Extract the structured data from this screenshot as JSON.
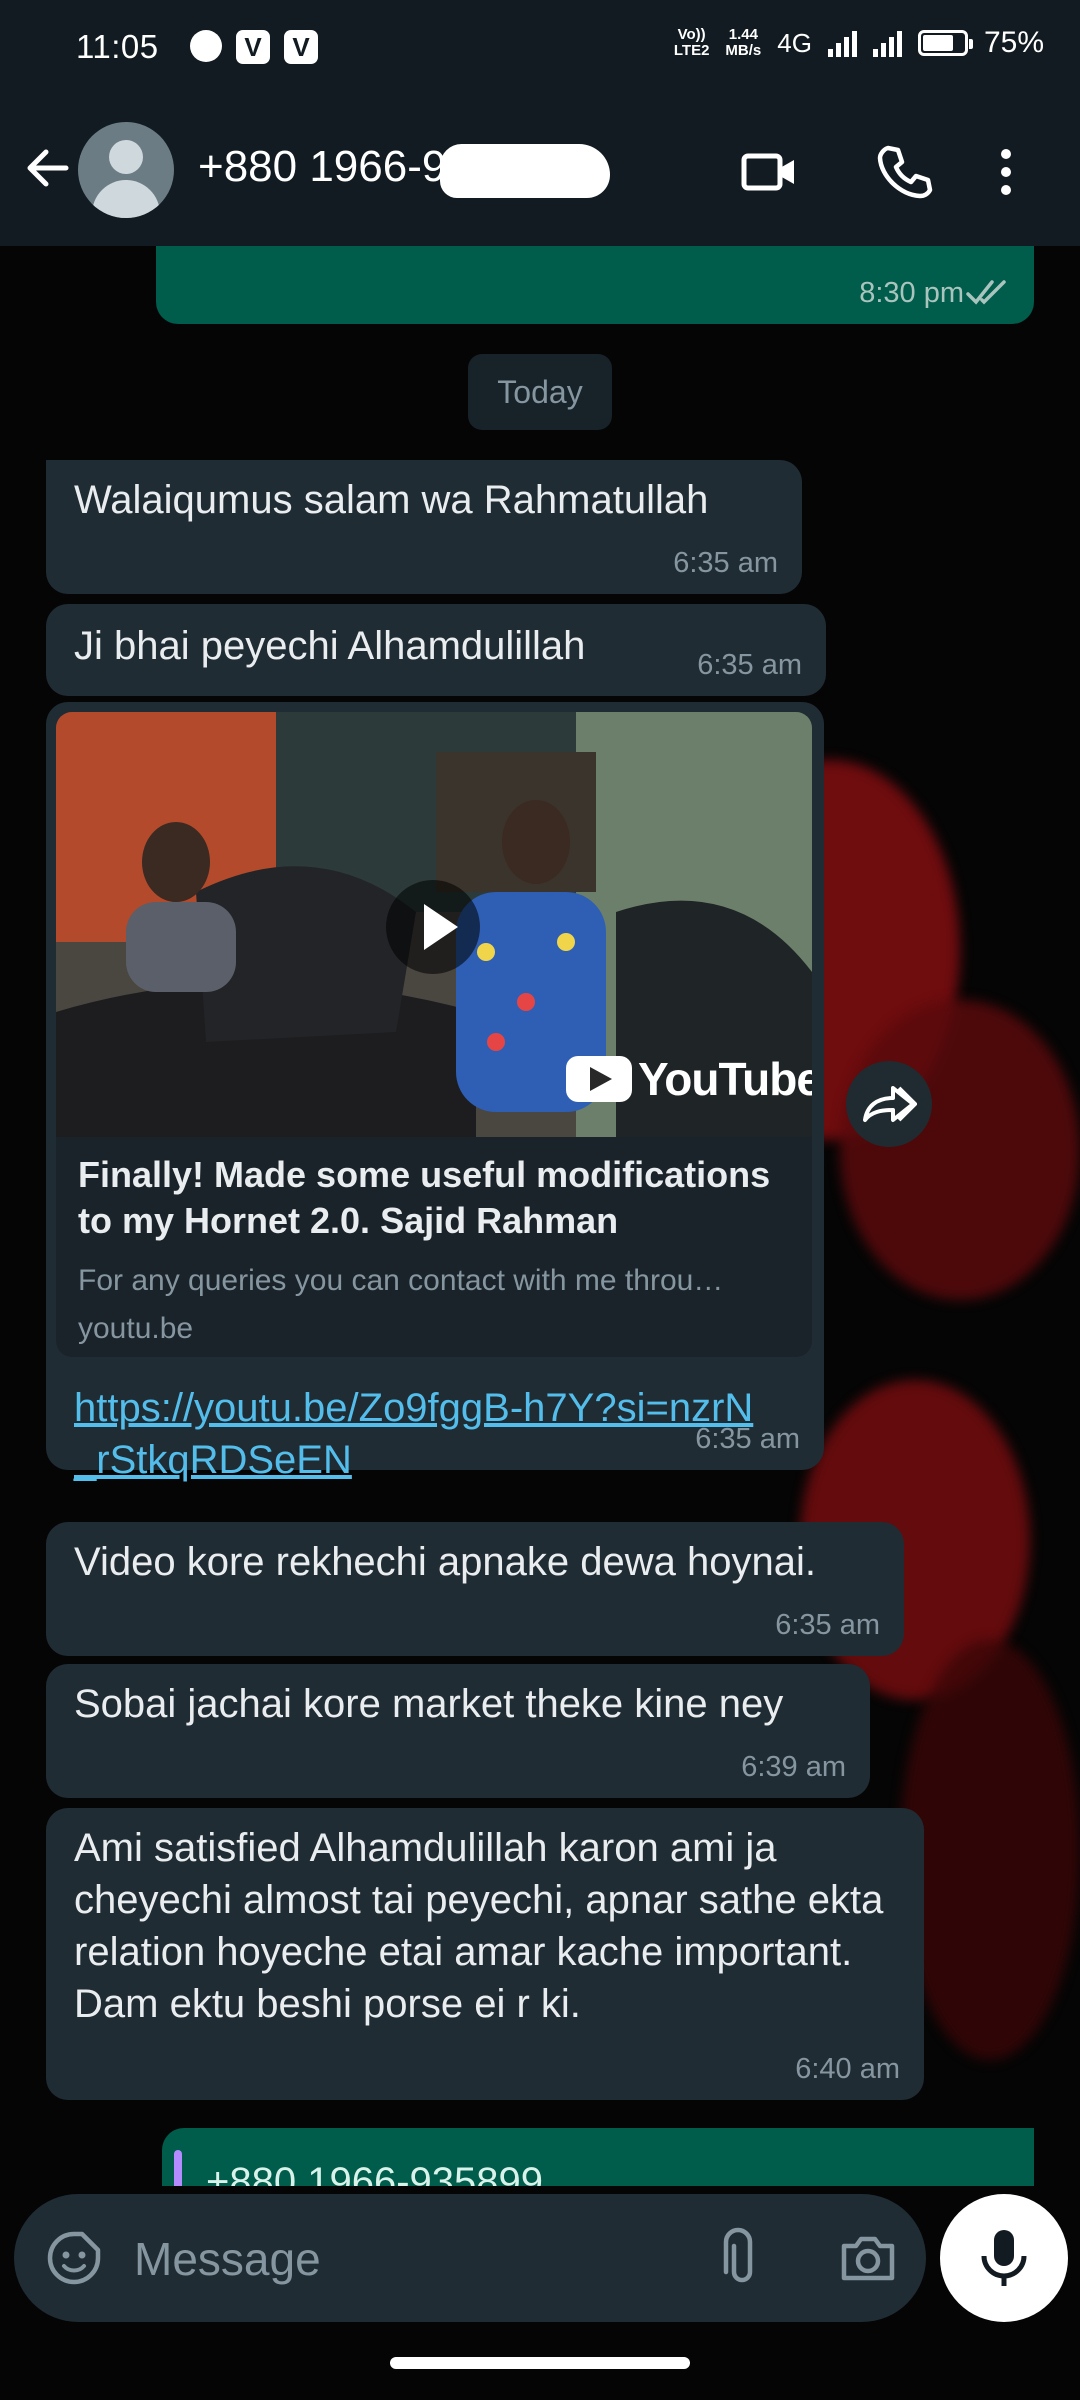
{
  "status_bar": {
    "time": "11:05",
    "volte": "Vo))",
    "lte": "LTE2",
    "speed_value": "1.44",
    "speed_unit": "MB/s",
    "network": "4G",
    "battery_percent": "75%",
    "battery_level": 0.75
  },
  "header": {
    "contact_name": "+880 1966-93",
    "icons": [
      "back-arrow-icon",
      "avatar",
      "video-call-icon",
      "phone-icon",
      "more-vert-icon"
    ]
  },
  "chat": {
    "prev_out_time": "8:30 pm",
    "date_chip": "Today",
    "messages": [
      {
        "text": "Walaiqumus salam wa Rahmatullah",
        "time": "6:35 am"
      },
      {
        "text": "Ji bhai peyechi Alhamdulillah",
        "time": "6:35 am"
      },
      {
        "card_title": "Finally! Made some useful modifications to my Hornet 2.0. Sajid Rahman",
        "card_desc": "For any queries you can contact with me throu…",
        "card_domain": "youtu.be",
        "youtube_label": "YouTube",
        "link": "https://youtu.be/Zo9fggB-h7Y?si=nzrN_rStkqRDSeEN",
        "time": "6:35 am"
      },
      {
        "text": "Video kore rekhechi apnake dewa hoynai.",
        "time": "6:35 am"
      },
      {
        "text": "Sobai jachai kore market theke kine ney",
        "time": "6:39 am"
      },
      {
        "text": "Ami satisfied Alhamdulillah karon ami ja cheyechi almost tai peyechi,  apnar sathe ekta relation hoyeche etai amar kache important. Dam ektu beshi porse ei r ki.",
        "time": "6:40 am"
      }
    ],
    "partial_out_text": "+880 1966-935899"
  },
  "input": {
    "placeholder": "Message"
  },
  "colors": {
    "header_bg": "#111b21",
    "incoming_bubble": "#202c33",
    "outgoing_bubble": "#005c4b",
    "link": "#53bdeb",
    "meta_text": "#8696a0"
  }
}
